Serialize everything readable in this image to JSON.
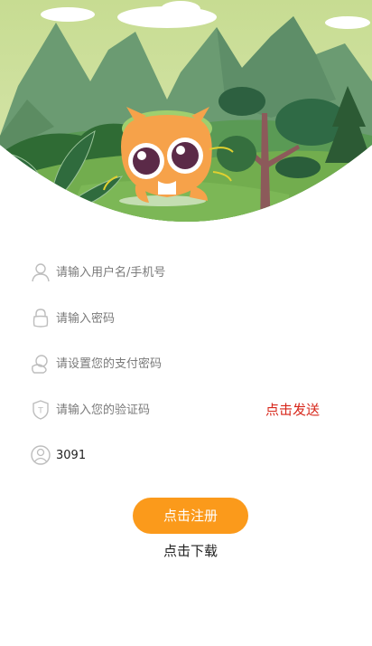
{
  "form": {
    "username": {
      "placeholder": "请输入用户名/手机号",
      "icon": "user-icon"
    },
    "password": {
      "placeholder": "请输入密码",
      "icon": "lock-icon"
    },
    "pay_password": {
      "placeholder": "请设置您的支付密码",
      "icon": "wallet-icon"
    },
    "verify_code": {
      "placeholder": "请输入您的验证码",
      "icon": "shield-icon",
      "send_label": "点击发送"
    },
    "captcha": {
      "value": "3091",
      "icon": "face-icon"
    }
  },
  "actions": {
    "register_label": "点击注册",
    "download_label": "点击下载"
  },
  "colors": {
    "accent": "#fb9a1b",
    "send_code": "#d7261a",
    "sky": "#cfe0a0",
    "grass": "#72ad4e"
  }
}
